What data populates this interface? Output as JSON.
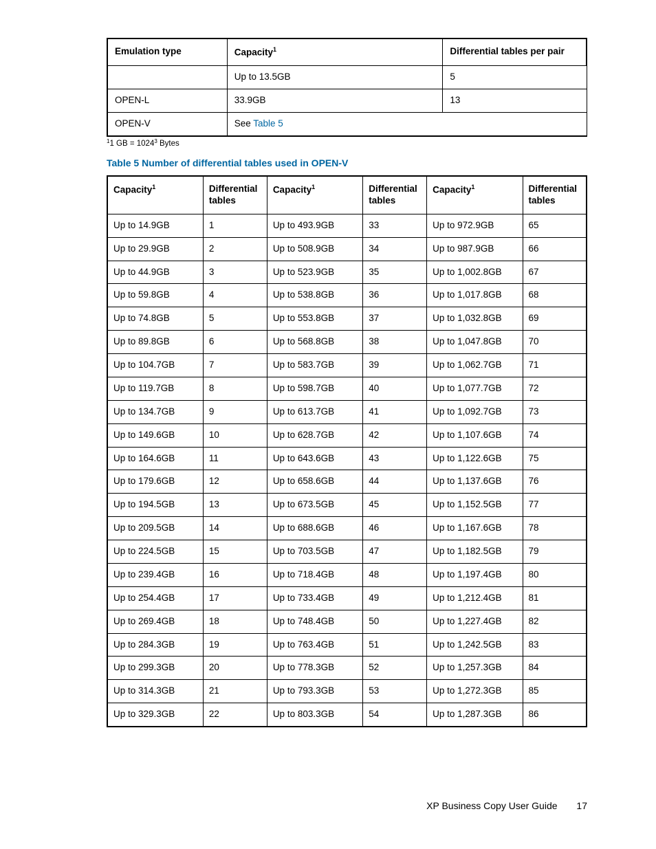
{
  "table1": {
    "headers": {
      "c1": "Emulation type",
      "c2": "Capacity",
      "c2_sup": "1",
      "c3": "Differential tables per pair"
    },
    "rows": [
      {
        "c1": "",
        "c2": "Up to 13.5GB",
        "c3": "5"
      },
      {
        "c1": "OPEN-L",
        "c2": "33.9GB",
        "c3": "13"
      },
      {
        "c1": "OPEN-V",
        "c2_prefix": "See ",
        "c2_link": "Table 5",
        "span23": true
      }
    ]
  },
  "footnote": {
    "sup1": "1",
    "text1": "1 GB = 1024",
    "sup2": "3",
    "text2": " Bytes"
  },
  "table5": {
    "caption": "Table 5 Number of differential tables used in OPEN-V",
    "col_labels": {
      "cap": "Capacity",
      "cap_sup": "1",
      "dif": "Differen­tial tables"
    },
    "rows": [
      {
        "a": "Up to 14.9GB",
        "av": "1",
        "b": "Up to 493.9GB",
        "bv": "33",
        "c": "Up to 972.9GB",
        "cv": "65"
      },
      {
        "a": "Up to 29.9GB",
        "av": "2",
        "b": "Up to 508.9GB",
        "bv": "34",
        "c": "Up to 987.9GB",
        "cv": "66"
      },
      {
        "a": "Up to 44.9GB",
        "av": "3",
        "b": "Up to 523.9GB",
        "bv": "35",
        "c": "Up to 1,002.8GB",
        "cv": "67"
      },
      {
        "a": "Up to 59.8GB",
        "av": "4",
        "b": "Up to 538.8GB",
        "bv": "36",
        "c": "Up to 1,017.8GB",
        "cv": "68"
      },
      {
        "a": "Up to 74.8GB",
        "av": "5",
        "b": "Up to 553.8GB",
        "bv": "37",
        "c": "Up to 1,032.8GB",
        "cv": "69"
      },
      {
        "a": "Up to 89.8GB",
        "av": "6",
        "b": "Up to 568.8GB",
        "bv": "38",
        "c": "Up to 1,047.8GB",
        "cv": "70"
      },
      {
        "a": "Up to 104.7GB",
        "av": "7",
        "b": "Up to 583.7GB",
        "bv": "39",
        "c": "Up to 1,062.7GB",
        "cv": "71"
      },
      {
        "a": "Up to 119.7GB",
        "av": "8",
        "b": "Up to 598.7GB",
        "bv": "40",
        "c": "Up to 1,077.7GB",
        "cv": "72"
      },
      {
        "a": "Up to 134.7GB",
        "av": "9",
        "b": "Up to 613.7GB",
        "bv": "41",
        "c": "Up to 1,092.7GB",
        "cv": "73"
      },
      {
        "a": "Up to 149.6GB",
        "av": "10",
        "b": "Up to 628.7GB",
        "bv": "42",
        "c": "Up to 1,107.6GB",
        "cv": "74"
      },
      {
        "a": "Up to 164.6GB",
        "av": "11",
        "b": "Up to 643.6GB",
        "bv": "43",
        "c": "Up to 1,122.6GB",
        "cv": "75"
      },
      {
        "a": "Up to 179.6GB",
        "av": "12",
        "b": "Up to 658.6GB",
        "bv": "44",
        "c": "Up to 1,137.6GB",
        "cv": "76"
      },
      {
        "a": "Up to 194.5GB",
        "av": "13",
        "b": "Up to 673.5GB",
        "bv": "45",
        "c": "Up to 1,152.5GB",
        "cv": "77"
      },
      {
        "a": "Up to 209.5GB",
        "av": "14",
        "b": "Up to 688.6GB",
        "bv": "46",
        "c": "Up to 1,167.6GB",
        "cv": "78"
      },
      {
        "a": "Up to 224.5GB",
        "av": "15",
        "b": "Up to 703.5GB",
        "bv": "47",
        "c": "Up to 1,182.5GB",
        "cv": "79"
      },
      {
        "a": "Up to 239.4GB",
        "av": "16",
        "b": "Up to 718.4GB",
        "bv": "48",
        "c": "Up to 1,197.4GB",
        "cv": "80"
      },
      {
        "a": "Up to 254.4GB",
        "av": "17",
        "b": "Up to 733.4GB",
        "bv": "49",
        "c": "Up to 1,212.4GB",
        "cv": "81"
      },
      {
        "a": "Up to 269.4GB",
        "av": "18",
        "b": "Up to 748.4GB",
        "bv": "50",
        "c": "Up to 1,227.4GB",
        "cv": "82"
      },
      {
        "a": "Up to 284.3GB",
        "av": "19",
        "b": "Up to 763.4GB",
        "bv": "51",
        "c": "Up to 1,242.5GB",
        "cv": "83"
      },
      {
        "a": "Up to 299.3GB",
        "av": "20",
        "b": "Up to 778.3GB",
        "bv": "52",
        "c": "Up to 1,257.3GB",
        "cv": "84"
      },
      {
        "a": "Up to 314.3GB",
        "av": "21",
        "b": "Up to 793.3GB",
        "bv": "53",
        "c": "Up to 1,272.3GB",
        "cv": "85"
      },
      {
        "a": "Up to 329.3GB",
        "av": "22",
        "b": "Up to 803.3GB",
        "bv": "54",
        "c": "Up to 1,287.3GB",
        "cv": "86"
      }
    ]
  },
  "footer": {
    "title": "XP Business Copy User Guide",
    "page": "17"
  }
}
